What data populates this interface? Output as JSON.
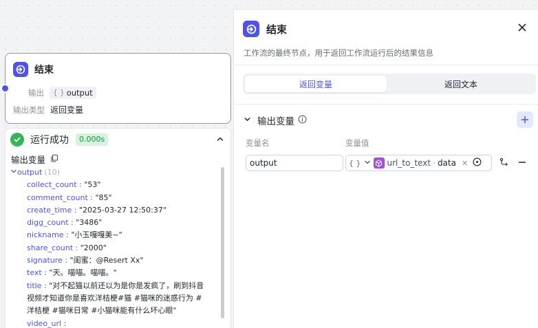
{
  "node": {
    "title": "结束",
    "output_label": "输出",
    "output_tag": "output",
    "output_type_label": "输出类型",
    "output_type_value": "返回变量"
  },
  "result": {
    "status": "运行成功",
    "time": "0.000s",
    "output_label": "输出变量",
    "root_key": "output",
    "root_count": "(10)",
    "items": [
      {
        "key": "collect_count",
        "value": "\"53\""
      },
      {
        "key": "comment_count",
        "value": "\"85\""
      },
      {
        "key": "create_time",
        "value": "\"2025-03-27 12:50:37\""
      },
      {
        "key": "digg_count",
        "value": "\"3486\""
      },
      {
        "key": "nickname",
        "value": "\"小玉嘎嘎美~\""
      },
      {
        "key": "share_count",
        "value": "\"2000\""
      },
      {
        "key": "signature",
        "value": "\"闺蜜：@Resert Xx\""
      },
      {
        "key": "text",
        "value": "\"天。喵喵。喵喵。\""
      },
      {
        "key": "title",
        "value": "\"对不起猫以前还以为是你是发疯了，刷到抖音视频才知道你是喜欢洋桔梗#猫 #猫咪的迷惑行为 #洋桔梗 #猫咪日常 #小猫咪能有什么坏心眼\""
      },
      {
        "key": "video_url",
        "value": ""
      }
    ]
  },
  "panel": {
    "title": "结束",
    "description": "工作流的最终节点，用于返回工作流运行后的结果信息",
    "tab_active": "返回变量",
    "tab_inactive": "返回文本",
    "section_title": "输出变量",
    "col_name": "变量名",
    "col_value": "变量值",
    "var_name": "output",
    "var_type": "{ }",
    "ref_source": "url_to_text",
    "ref_field": "data"
  },
  "colors": {
    "accent": "#4d53e8",
    "success": "#35b459",
    "plugin": "#a34fd9"
  }
}
